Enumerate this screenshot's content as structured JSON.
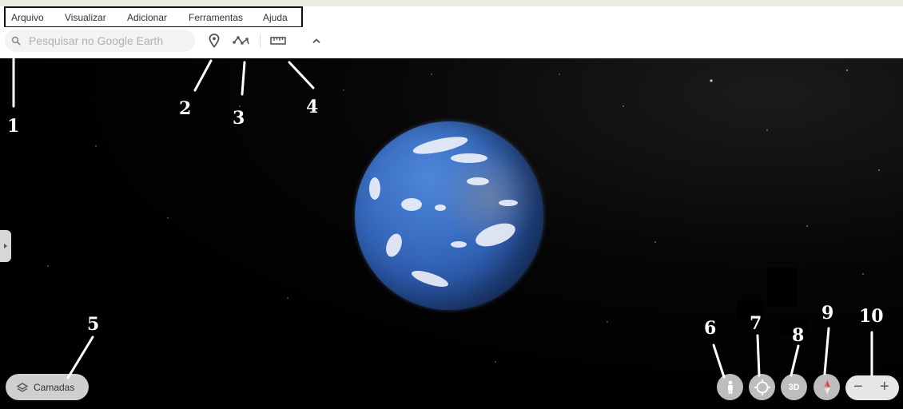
{
  "menu": {
    "items": [
      "Arquivo",
      "Visualizar",
      "Adicionar",
      "Ferramentas",
      "Ajuda"
    ]
  },
  "search": {
    "placeholder": "Pesquisar no Google Earth",
    "icon": "search-icon"
  },
  "toolbar": {
    "icons": [
      "placemark-icon",
      "path-icon",
      "ruler-icon",
      "collapse-chevron-icon"
    ]
  },
  "layers": {
    "label": "Camadas",
    "icon": "layers-icon"
  },
  "controls": {
    "three_d_label": "3D",
    "zoom_out": "−",
    "zoom_in": "+",
    "icons": [
      "pegman-icon",
      "my-location-icon",
      "compass-icon"
    ]
  },
  "annotations": {
    "n1": "1",
    "n2": "2",
    "n3": "3",
    "n4": "4",
    "n5": "5",
    "n6": "6",
    "n7": "7",
    "n8": "8",
    "n9": "9",
    "n10": "10"
  },
  "colors": {
    "toolbar_bg": "#ffffff",
    "space_bg": "#000000",
    "globe_ocean": "#3a6fc4",
    "button_bg": "#bdbdbd",
    "compass_red": "#e53935"
  }
}
